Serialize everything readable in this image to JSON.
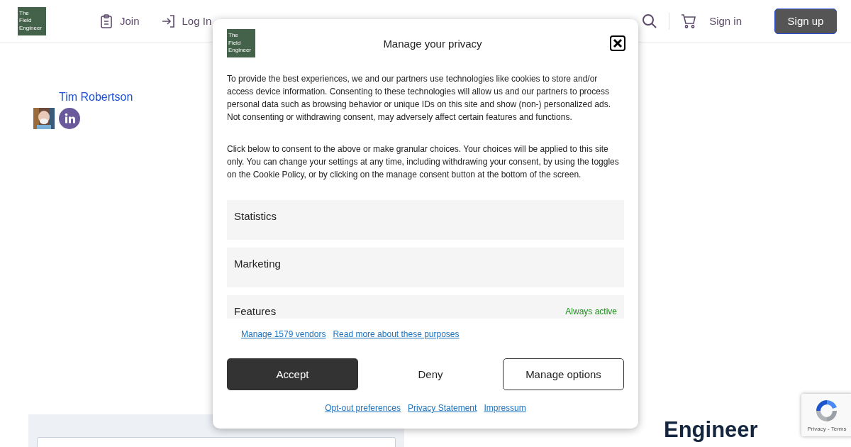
{
  "header": {
    "logo": "The Field Engineer",
    "nav": [
      {
        "label": "Join"
      },
      {
        "label": "Log In"
      }
    ],
    "sign_in": "Sign in",
    "sign_up": "Sign up"
  },
  "author": {
    "name": "Tim Robertson"
  },
  "support_heading": "Engineer",
  "consent": {
    "logo": "The Field Engineer",
    "title": "Manage your privacy",
    "paragraphs": [
      "To provide the best experiences, we and our partners use technologies like cookies to store and/or access device information. Consenting to these technologies will allow us and our partners to process personal data such as browsing behavior or unique IDs on this site and show (non-) personalized ads. Not consenting or withdrawing consent, may adversely affect certain features and functions.",
      "Click below to consent to the above or make granular choices. Your choices will be applied to this site only. You can change your settings at any time, including withdrawing your consent, by using the toggles on the Cookie Policy, or by clicking on the manage consent button at the bottom of the screen."
    ],
    "categories": [
      {
        "label": "Statistics"
      },
      {
        "label": "Marketing"
      },
      {
        "label": "Features",
        "status": "Always active"
      }
    ],
    "links": [
      "Manage 1579 vendors",
      "Read more about these purposes"
    ],
    "buttons": [
      {
        "label": "Accept",
        "kind": "primary"
      },
      {
        "label": "Deny",
        "kind": "plain"
      },
      {
        "label": "Manage options",
        "kind": "outline"
      }
    ],
    "footer_links": [
      "Opt-out preferences",
      "Privacy Statement",
      "Impressum"
    ]
  },
  "recaptcha": {
    "links": "Privacy - Terms"
  }
}
